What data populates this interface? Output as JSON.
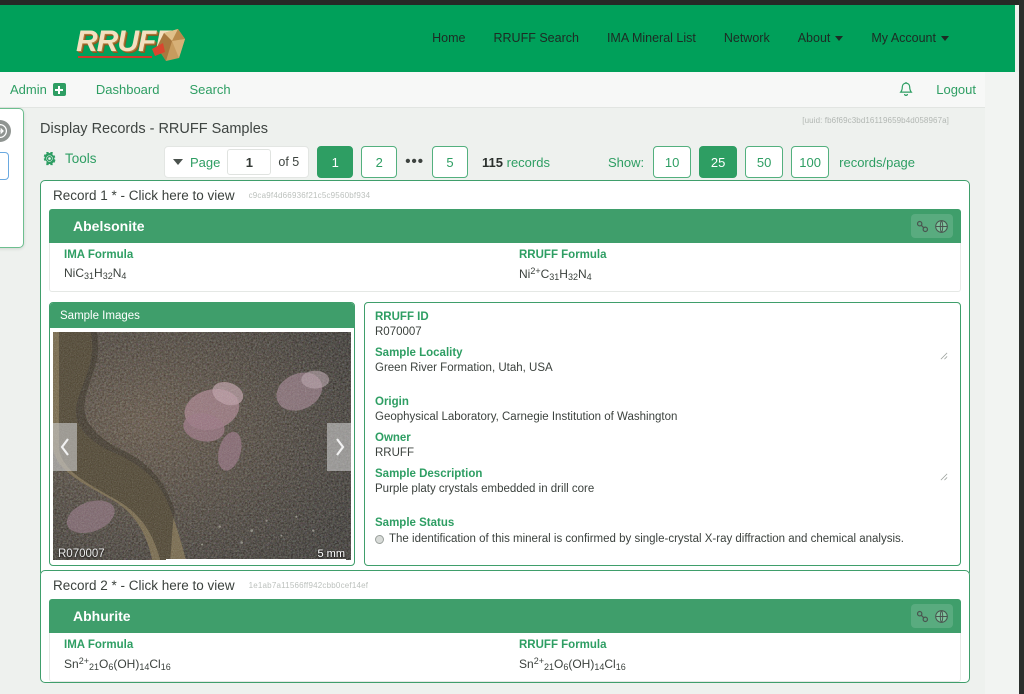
{
  "brand": {
    "logo_text": "RRUFF",
    "logo_icon": "gemstone-icon"
  },
  "mainnav": [
    {
      "label": "Home",
      "has_caret": false
    },
    {
      "label": "RRUFF Search",
      "has_caret": false
    },
    {
      "label": "IMA Mineral List",
      "has_caret": false
    },
    {
      "label": "Network",
      "has_caret": false
    },
    {
      "label": "About",
      "has_caret": true
    },
    {
      "label": "My Account",
      "has_caret": true
    }
  ],
  "adminbar": {
    "items": [
      {
        "label": "Admin",
        "icon": "plus-square-icon"
      },
      {
        "label": "Dashboard",
        "icon": null
      },
      {
        "label": "Search",
        "icon": null
      }
    ],
    "bell_icon": "bell-icon",
    "logout_label": "Logout",
    "help_icon": "question-circle-icon"
  },
  "page": {
    "title": "Display Records - RRUFF Samples",
    "uuid": "[uuid: fb6f69c3bd16119659b4d058967a]"
  },
  "toolbar": {
    "tools_label": "Tools",
    "tools_icon": "gear-icon",
    "page_label": "Page",
    "page_value": "1",
    "page_of": "of 5",
    "page_buttons": [
      "1",
      "2",
      "5"
    ],
    "page_active": "1",
    "ellipsis": "•••",
    "records_count": "115",
    "records_word": "records",
    "show_label": "Show:",
    "show_options": [
      "10",
      "25",
      "50",
      "100"
    ],
    "show_active": "25",
    "show_suffix": "records/page"
  },
  "records": [
    {
      "header": "Record 1 * - Click here to view",
      "hash": "c9ca9f4d66936f21c5c9560bf934",
      "mineral": "Abelsonite",
      "icons": [
        "link-icon",
        "globe-icon"
      ],
      "ima_formula_label": "IMA Formula",
      "ima_formula": "NiC31H32N4",
      "rruff_formula_label": "RRUFF Formula",
      "rruff_formula": "Ni2+C31H32N4",
      "images_panel_title": "Sample Images",
      "image_id_overlay": "R070007",
      "image_scale": "5 mm",
      "details": [
        {
          "label": "RRUFF ID",
          "value": "R070007",
          "textarea": false
        },
        {
          "label": "Sample Locality",
          "value": "Green River Formation, Utah, USA",
          "textarea": true
        },
        {
          "label": "Origin",
          "value": "Geophysical Laboratory, Carnegie Institution of Washington",
          "textarea": false
        },
        {
          "label": "Owner",
          "value": "RRUFF",
          "textarea": false
        },
        {
          "label": "Sample Description",
          "value": "Purple platy crystals embedded in drill core",
          "textarea": true
        }
      ],
      "status_label": "Sample Status",
      "status_text": "The identification of this mineral is confirmed by single-crystal X-ray diffraction and chemical analysis."
    },
    {
      "header": "Record 2 * - Click here to view",
      "hash": "1e1ab7a11566ff942cbb0cef14ef",
      "mineral": "Abhurite",
      "icons": [
        "link-icon",
        "globe-icon"
      ],
      "ima_formula_label": "IMA Formula",
      "ima_formula": "Sn2+21O6(OH)14Cl16",
      "rruff_formula_label": "RRUFF Formula",
      "rruff_formula": "Sn2+21O6(OH)14Cl16"
    }
  ],
  "colors": {
    "brand_green": "#00a05a",
    "accent_green": "#2e9e63",
    "card_green": "#3f9e6b",
    "page_bg": "#f2f4f2"
  }
}
